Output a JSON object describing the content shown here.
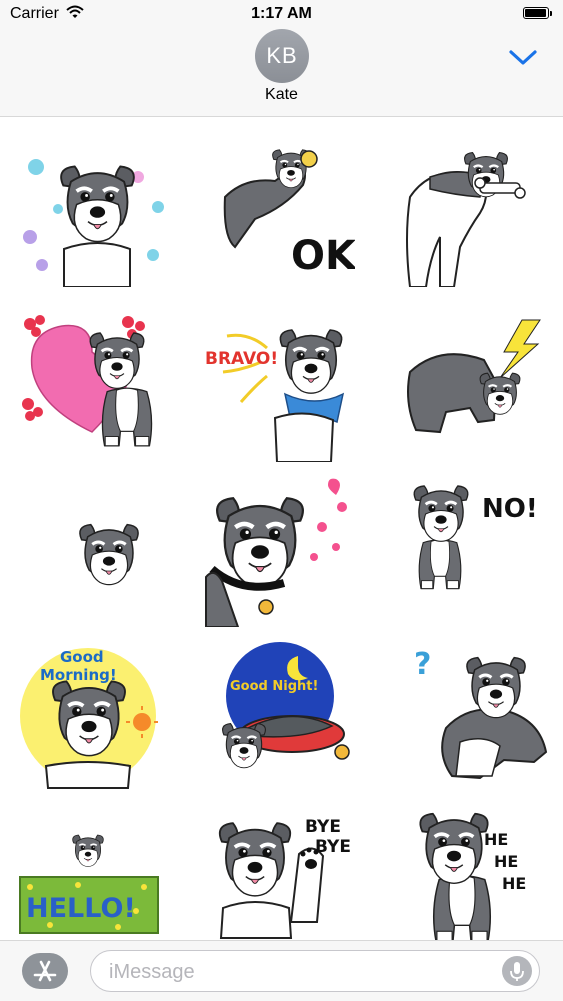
{
  "status_bar": {
    "carrier": "Carrier",
    "time": "1:17 AM"
  },
  "header": {
    "avatar_initials": "KB",
    "contact_name": "Kate",
    "accent_color": "#1a73e8"
  },
  "stickers": [
    {
      "name": "flowers"
    },
    {
      "name": "ok",
      "text": "OK!"
    },
    {
      "name": "bone"
    },
    {
      "name": "heart"
    },
    {
      "name": "bravo",
      "text": "BRAVO!"
    },
    {
      "name": "lightning"
    },
    {
      "name": "small-head"
    },
    {
      "name": "wink"
    },
    {
      "name": "no",
      "text": "NO!"
    },
    {
      "name": "good-morning",
      "text_line1": "Good",
      "text_line2": "Morning!"
    },
    {
      "name": "good-night",
      "text": "Good Night!"
    },
    {
      "name": "question",
      "text": "?"
    },
    {
      "name": "hello",
      "text": "HELLO!"
    },
    {
      "name": "bye-bye",
      "text_line1": "BYE",
      "text_line2": "BYE"
    },
    {
      "name": "hehehe",
      "text_line1": "HE",
      "text_line2": "HE",
      "text_line3": "HE"
    }
  ],
  "input_bar": {
    "placeholder": "iMessage"
  }
}
